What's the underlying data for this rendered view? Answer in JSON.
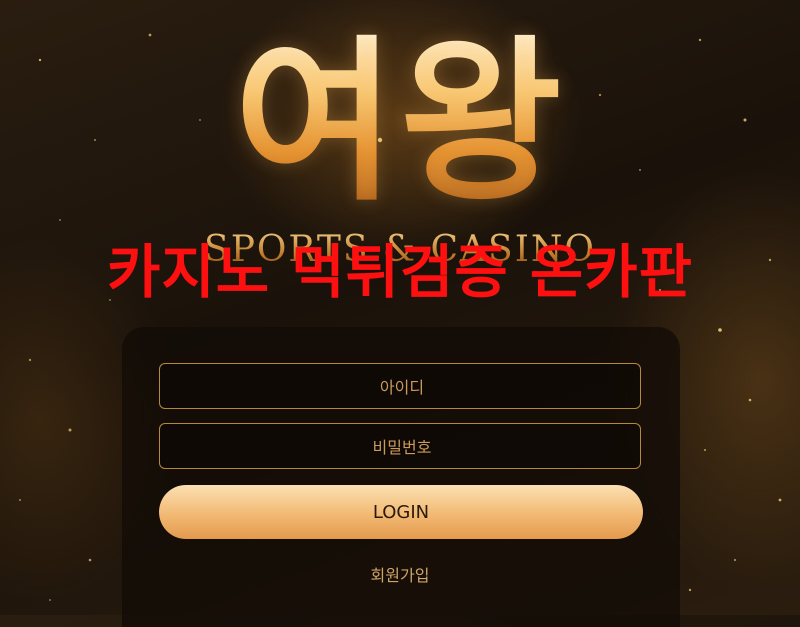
{
  "logo": {
    "main_text": "여왕",
    "sub_text": "SPORTS & CASINO"
  },
  "overlay_caption": "카지노 먹튀검증 온카판",
  "login_form": {
    "id_placeholder": "아이디",
    "password_placeholder": "비밀번호",
    "login_label": "LOGIN",
    "signup_label": "회원가입"
  },
  "colors": {
    "accent_gold": "#b8873c",
    "caption_red": "#ff1010",
    "button_gradient_top": "#fbe0b2",
    "button_gradient_bottom": "#e49a4e"
  }
}
